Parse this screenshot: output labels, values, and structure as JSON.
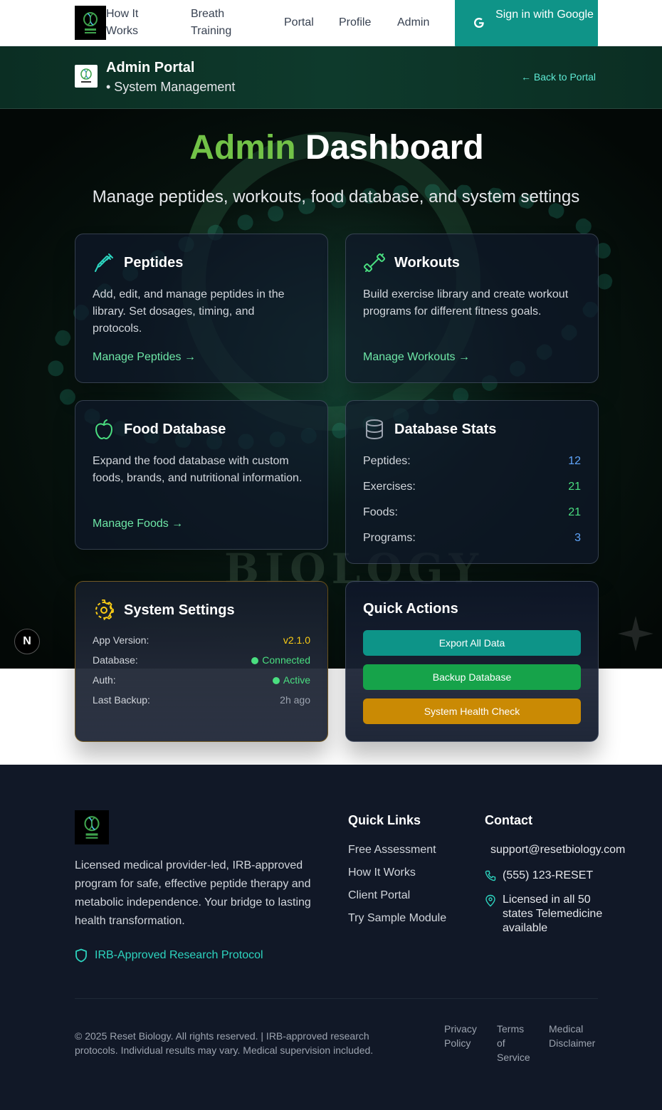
{
  "nav": {
    "links": [
      "How It Works",
      "Breath Training",
      "Portal",
      "Profile",
      "Admin"
    ],
    "signin": "Sign in with Google"
  },
  "portal_bar": {
    "title": "Admin Portal",
    "subtitle": "• System Management",
    "back": "← Back to Portal"
  },
  "hero": {
    "title_accent": "Admin",
    "title_rest": "Dashboard",
    "subtitle": "Manage peptides, workouts, food database, and system settings"
  },
  "cards": {
    "peptides": {
      "title": "Peptides",
      "desc": "Add, edit, and manage peptides in the library. Set dosages, timing, and protocols.",
      "link": "Manage Peptides →",
      "icon": "syringe-icon"
    },
    "workouts": {
      "title": "Workouts",
      "desc": "Build exercise library and create workout programs for different fitness goals.",
      "link": "Manage Workouts →",
      "icon": "dumbbell-icon"
    },
    "foods": {
      "title": "Food Database",
      "desc": "Expand the food database with custom foods, brands, and nutritional information.",
      "link": "Manage Foods →",
      "icon": "apple-icon"
    },
    "stats": {
      "title": "Database Stats",
      "icon": "database-icon",
      "rows": [
        {
          "label": "Peptides:",
          "value": "12",
          "color": "#60a5fa"
        },
        {
          "label": "Exercises:",
          "value": "21",
          "color": "#4ade80"
        },
        {
          "label": "Foods:",
          "value": "21",
          "color": "#4ade80"
        },
        {
          "label": "Programs:",
          "value": "3",
          "color": "#60a5fa"
        }
      ]
    },
    "settings": {
      "title": "System Settings",
      "icon": "gear-icon",
      "rows": [
        {
          "label": "App Version:",
          "value": "v2.1.0",
          "color": "#facc15"
        },
        {
          "label": "Database:",
          "value": "Connected",
          "color": "#4ade80"
        },
        {
          "label": "Auth:",
          "value": "Active",
          "color": "#4ade80"
        },
        {
          "label": "Last Backup:",
          "value": "2h ago",
          "color": "#9ca3af"
        }
      ]
    },
    "quick": {
      "title": "Quick Actions",
      "buttons": [
        {
          "label": "Export All Data",
          "color": "#0d9488"
        },
        {
          "label": "Backup Database",
          "color": "#16a34a"
        },
        {
          "label": "System Health Check",
          "color": "#ca8a04"
        }
      ]
    }
  },
  "footer": {
    "desc": "Licensed medical provider-led, IRB-approved program for safe, effective peptide therapy and metabolic independence. Your bridge to lasting health transformation.",
    "irb": "IRB-Approved Research Protocol",
    "quick_links_title": "Quick Links",
    "quick_links": [
      "Free Assessment",
      "How It Works",
      "Client Portal",
      "Try Sample Module"
    ],
    "contact_title": "Contact",
    "email": "support@resetbiology.com",
    "phone": "(555) 123-RESET",
    "location": "Licensed in all 50 states Telemedicine available",
    "copyright": "© 2025 Reset Biology. All rights reserved. | IRB-approved research protocols. Individual results may vary. Medical supervision included.",
    "legal": [
      "Privacy Policy",
      "Terms of Service",
      "Medical Disclaimer"
    ]
  },
  "background_text": "BIOLOGY",
  "next_badge": "N"
}
